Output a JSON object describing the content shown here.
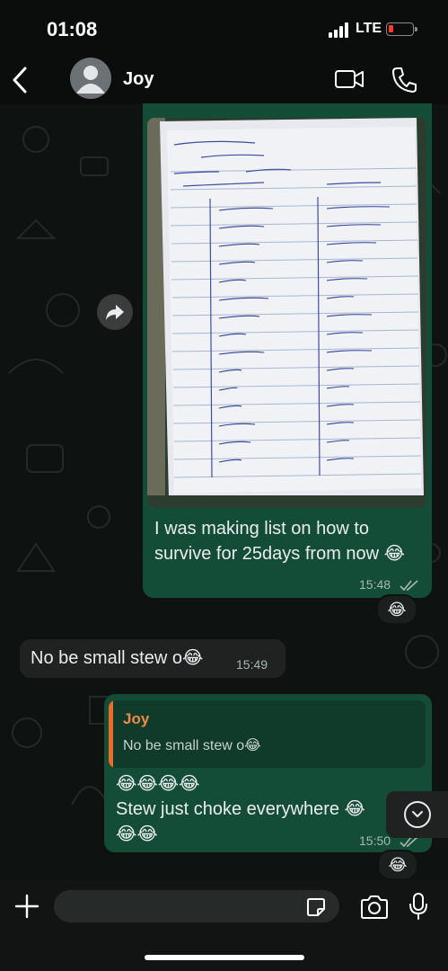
{
  "status": {
    "time": "01:08",
    "network": "LTE"
  },
  "header": {
    "contact_name": "Joy"
  },
  "messages": {
    "photo_message": {
      "caption": "I was making list on how to survive for 25days from now 😂",
      "time": "15:48",
      "reaction": "😂"
    },
    "incoming": {
      "text": "No be small stew o😂",
      "time": "15:49"
    },
    "reply": {
      "quote_name": "Joy",
      "quote_text": "No be small stew o😂",
      "line1": "😂😂😂😂",
      "line2": "Stew just choke everywhere 😂",
      "line3": "😂😂",
      "time": "15:50",
      "reaction": "😂"
    }
  },
  "composer": {
    "placeholder": ""
  },
  "colors": {
    "outgoing_bubble": "#144d37",
    "incoming_bubble": "#1f2221",
    "quote_accent": "#e86d2d",
    "battery_low": "#ff3b30"
  },
  "icons": [
    "back-arrow-icon",
    "avatar-placeholder-icon",
    "video-call-icon",
    "phone-call-icon",
    "forward-icon",
    "read-receipt-icon",
    "scroll-down-icon",
    "plus-icon",
    "sticker-icon",
    "camera-icon",
    "microphone-icon"
  ]
}
